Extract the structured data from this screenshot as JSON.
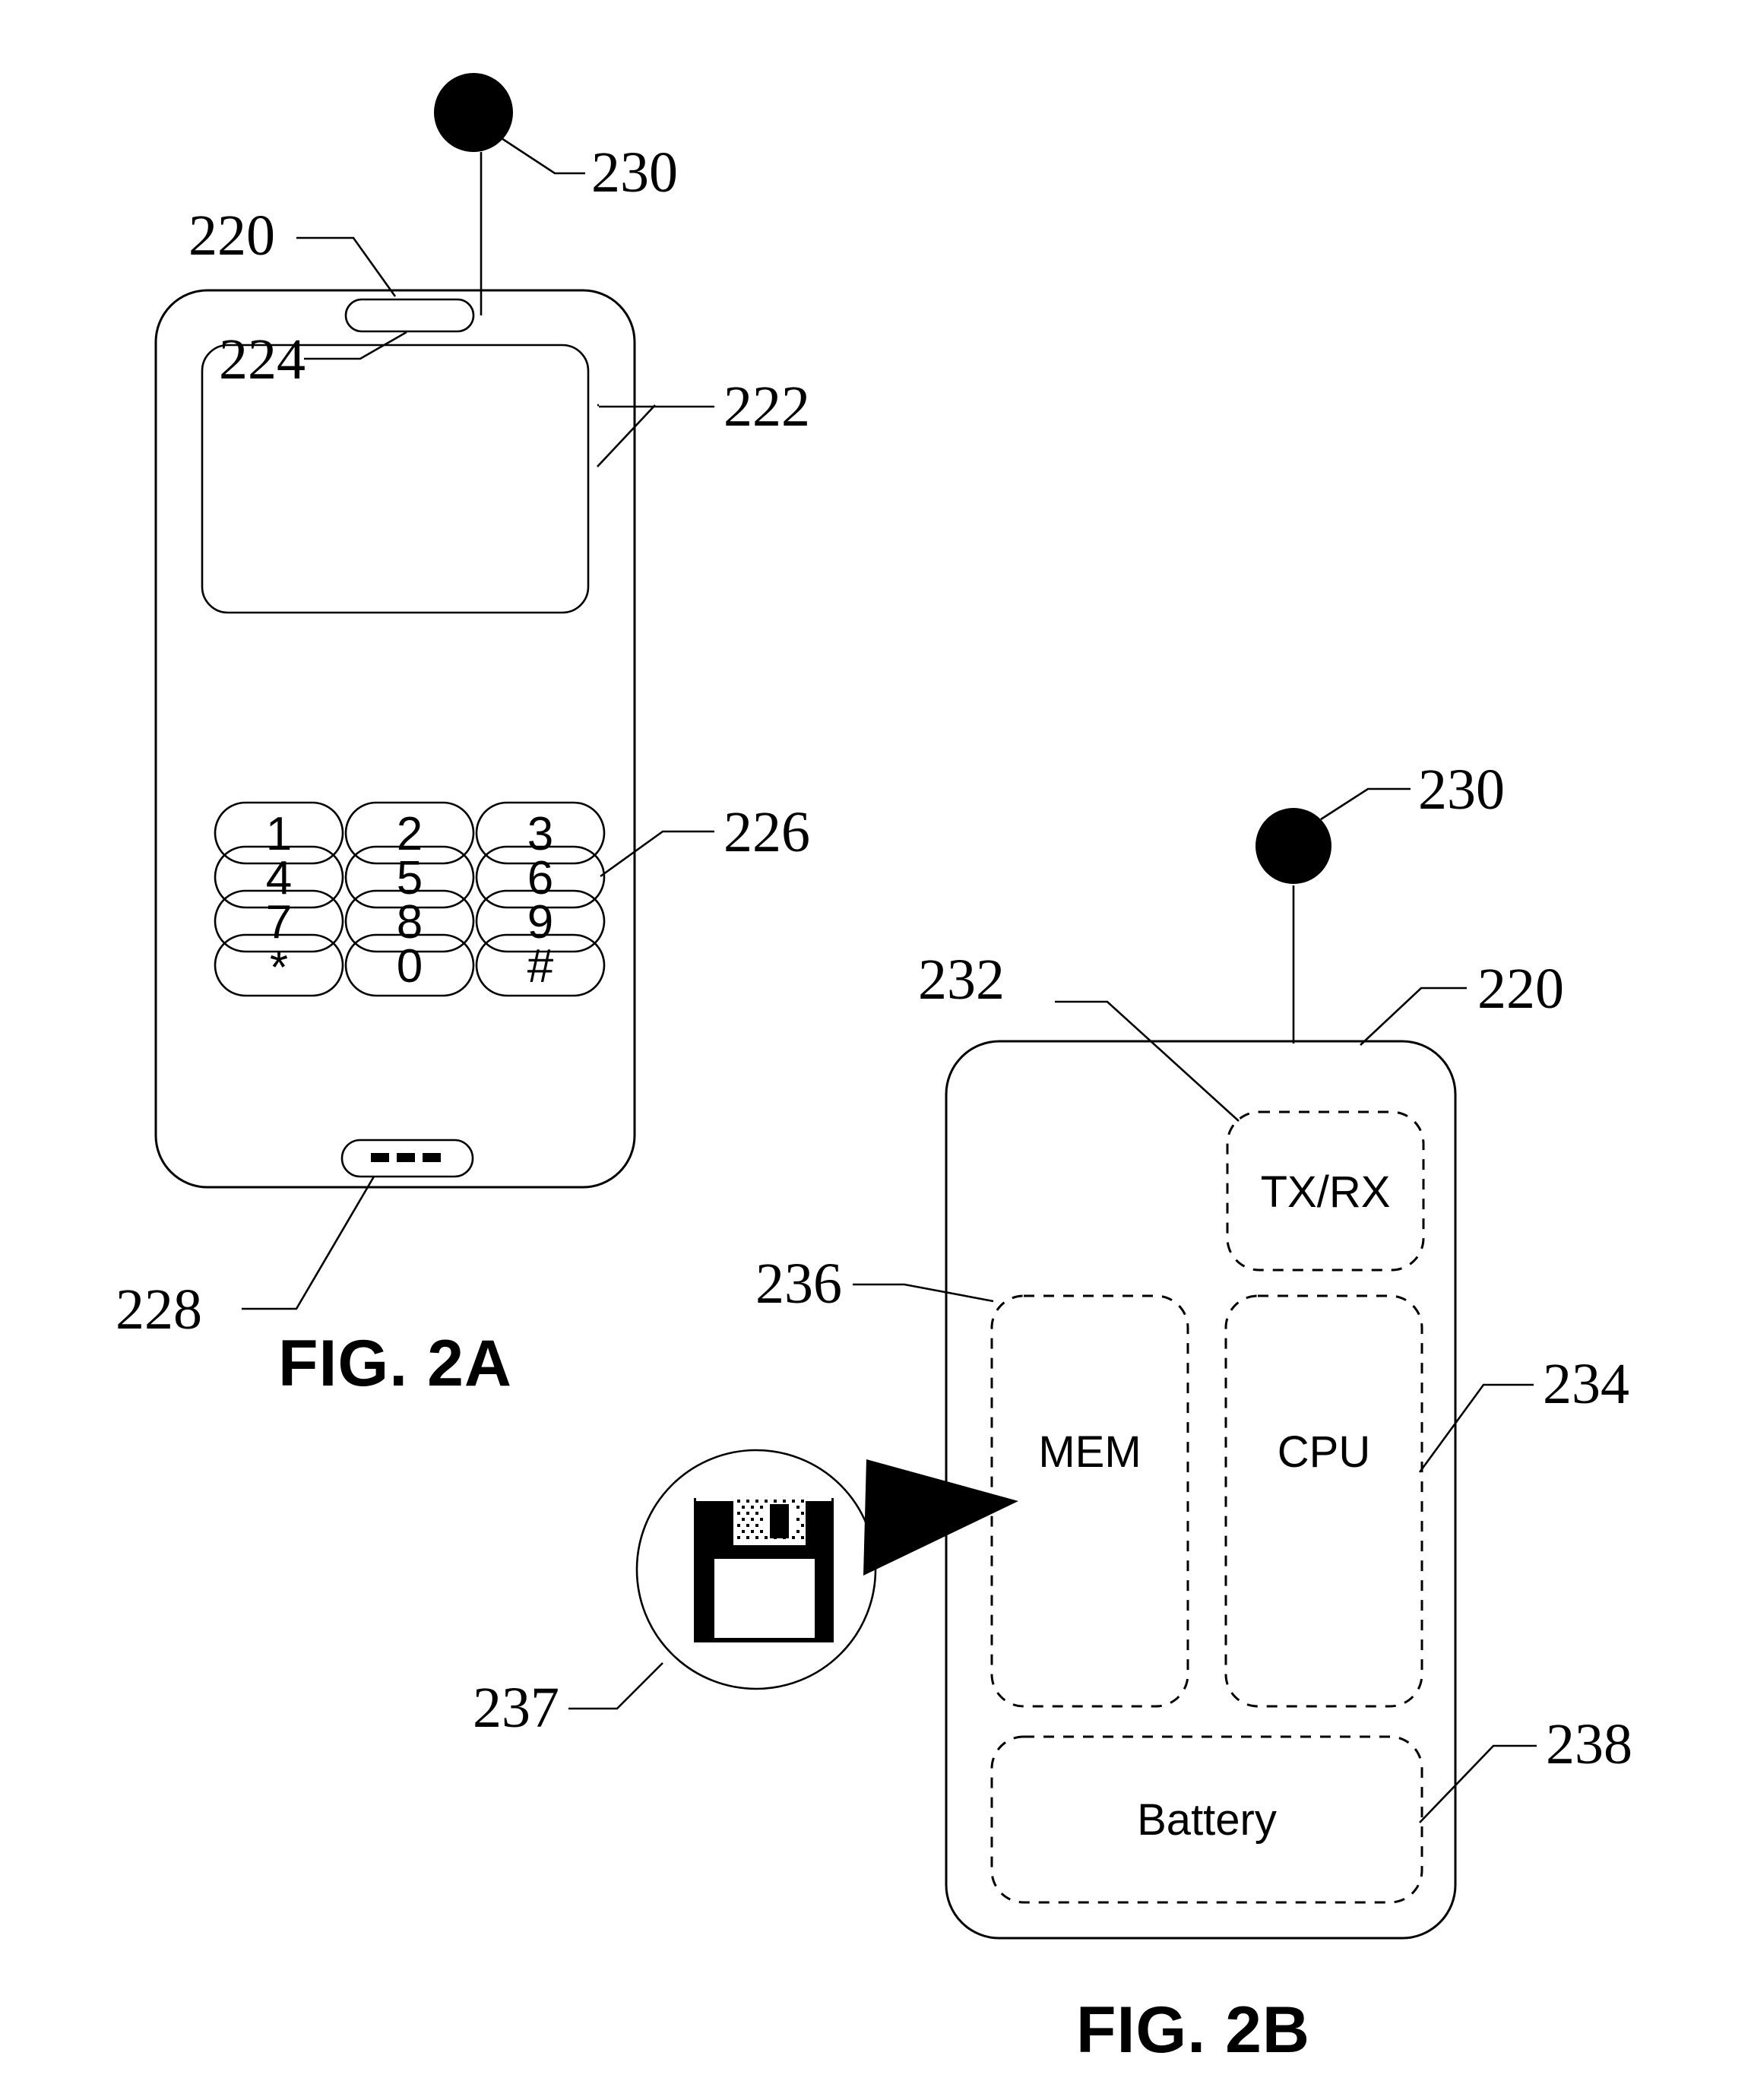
{
  "document": {
    "type": "patent-drawing-sheet",
    "figures": [
      "FIG. 2A",
      "FIG. 2B"
    ]
  },
  "fig2a": {
    "caption": "FIG. 2A",
    "reference_numerals": {
      "device": "220",
      "display": "222",
      "speaker": "224",
      "keypad": "226",
      "microphone": "228",
      "antenna": "230"
    },
    "keypad": {
      "rows": [
        [
          "1",
          "2",
          "3"
        ],
        [
          "4",
          "5",
          "6"
        ],
        [
          "7",
          "8",
          "9"
        ],
        [
          "*",
          "0",
          "#"
        ]
      ]
    },
    "microphone_glyph": "---"
  },
  "fig2b": {
    "caption": "FIG. 2B",
    "reference_numerals": {
      "device": "220",
      "antenna": "230",
      "transceiver": "232",
      "cpu": "234",
      "memory": "236",
      "memory_icon_callout": "237",
      "battery": "238"
    },
    "blocks": [
      {
        "id": "transceiver",
        "label": "TX/RX"
      },
      {
        "id": "memory",
        "label": "MEM"
      },
      {
        "id": "cpu",
        "label": "CPU"
      },
      {
        "id": "battery",
        "label": "Battery"
      }
    ],
    "callout_icon": "floppy-disk-icon"
  },
  "colors": {
    "ink": "#000000",
    "paper": "#ffffff"
  }
}
